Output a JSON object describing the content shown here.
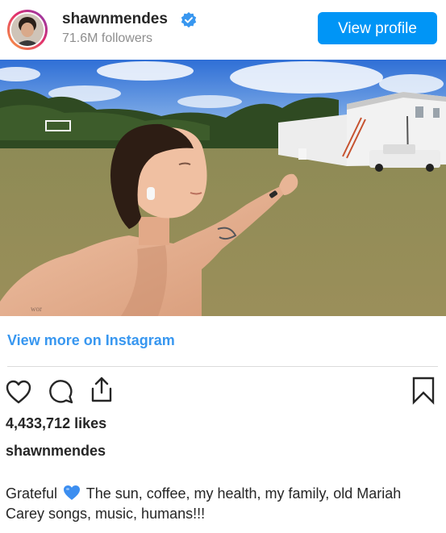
{
  "post": {
    "username": "shawnmendes",
    "followers": "71.6M followers",
    "view_profile_label": "View profile",
    "view_more_label": "View more on Instagram",
    "likes": "4,433,712 likes",
    "caption_username": "shawnmendes",
    "caption_prefix": "Grateful",
    "caption_emoji": "blue-heart",
    "caption_rest": "The sun, coffee, my health, my family, old Mariah Carey songs, music, humans!!!"
  },
  "colors": {
    "accent": "#0095f6",
    "link": "#3897f0",
    "verified": "#3897f0",
    "emoji_heart": "#3c8ef0"
  },
  "icons": [
    "verified-badge-icon",
    "heart-icon",
    "comment-icon",
    "share-icon",
    "bookmark-icon",
    "blue-heart-emoji-icon"
  ]
}
